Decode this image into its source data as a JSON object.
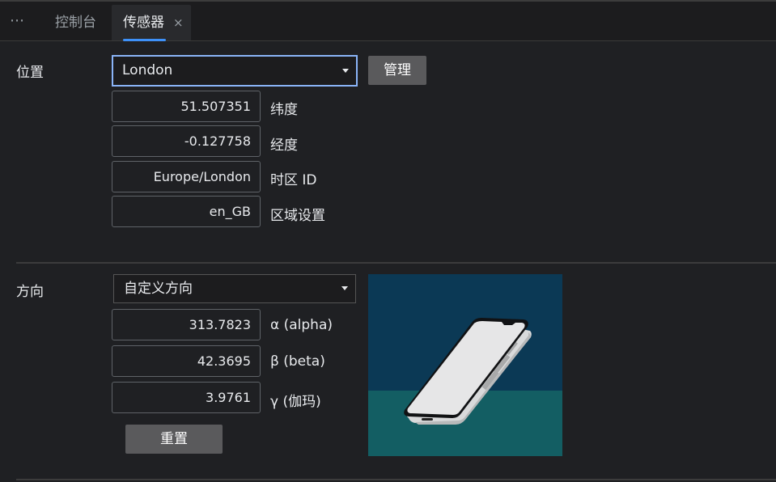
{
  "tabs": {
    "more_label": "⋯",
    "console_label": "控制台",
    "sensors_label": "传感器",
    "close_glyph": "×"
  },
  "location": {
    "section_label": "位置",
    "selected": "London",
    "manage_label": "管理",
    "fields": [
      {
        "value": "51.507351",
        "label": "纬度"
      },
      {
        "value": "-0.127758",
        "label": "经度"
      },
      {
        "value": "Europe/London",
        "label": "时区 ID"
      },
      {
        "value": "en_GB",
        "label": "区域设置"
      }
    ]
  },
  "orientation": {
    "section_label": "方向",
    "selected": "自定义方向",
    "fields": [
      {
        "value": "313.7823",
        "label": "α (alpha)"
      },
      {
        "value": "42.3695",
        "label": "β (beta)"
      },
      {
        "value": "3.9761",
        "label": "γ (伽玛)"
      }
    ],
    "reset_label": "重置"
  },
  "colors": {
    "accent": "#3e91f8",
    "sky": "#0b3955",
    "floor": "#135e63"
  }
}
